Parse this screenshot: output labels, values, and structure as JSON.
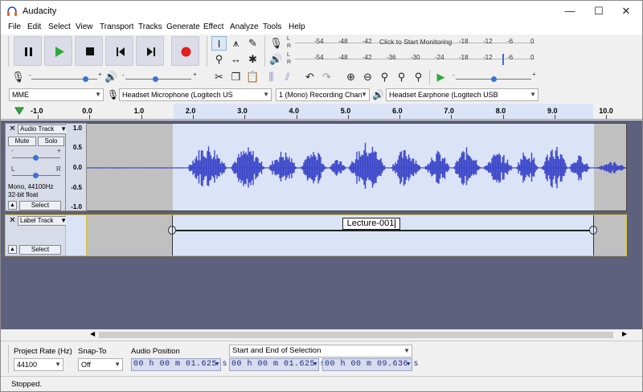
{
  "window": {
    "title": "Audacity",
    "minimize": "—",
    "maximize": "☐",
    "close": "✕"
  },
  "menu": [
    "File",
    "Edit",
    "Select",
    "View",
    "Transport",
    "Tracks",
    "Generate",
    "Effect",
    "Analyze",
    "Tools",
    "Help"
  ],
  "meters": {
    "record_ticks": [
      "-54",
      "-48",
      "-42",
      "-18",
      "-12",
      "-6",
      "0"
    ],
    "record_prompt": "Click to Start Monitoring",
    "playback_ticks": [
      "-54",
      "-48",
      "-42",
      "-36",
      "-30",
      "-24",
      "-18",
      "-12",
      "-6",
      "0"
    ],
    "left_label": "L",
    "right_label": "R"
  },
  "mixer": {
    "record_volume": 0.82,
    "playback_volume": 0.45,
    "minus": "-",
    "plus": "+"
  },
  "playspeed": {
    "value": 0.5,
    "minus": "-",
    "plus": "+"
  },
  "device": {
    "host": "MME",
    "input": "Headset Microphone (Logitech US",
    "channels": "1 (Mono) Recording Chan",
    "output": "Headset Earphone (Logitech USB"
  },
  "ruler": {
    "labels": [
      "-1.0",
      "0.0",
      "1.0",
      "2.0",
      "3.0",
      "4.0",
      "5.0",
      "6.0",
      "7.0",
      "8.0",
      "9.0",
      "10.0"
    ]
  },
  "audio_track": {
    "name": "Audio Track",
    "mute": "Mute",
    "solo": "Solo",
    "gain_minus": "-",
    "gain_plus": "+",
    "pan_left": "L",
    "pan_right": "R",
    "info_line1": "Mono, 44100Hz",
    "info_line2": "32-bit float",
    "select": "Select",
    "scale": [
      "1.0",
      "0.5",
      "0.0",
      "-0.5",
      "-1.0"
    ]
  },
  "label_track": {
    "name": "Label Track",
    "select": "Select",
    "label_text": "Lecture-001"
  },
  "selection_toolbar": {
    "project_rate_label": "Project Rate (Hz)",
    "project_rate": "44100",
    "snap_to_label": "Snap-To",
    "snap_to": "Off",
    "audio_position_label": "Audio Position",
    "audio_position": "00 h 00 m 01.625 s",
    "selection_mode": "Start and End of Selection",
    "selection_start": "00 h 00 m 01.625 s",
    "selection_end": "00 h 00 m 09.636 s"
  },
  "status": {
    "text": "Stopped."
  },
  "colors": {
    "waveform": "#3b46c9",
    "selection_bg": "#dbe4f7",
    "unselected_bg": "#c0c0c0",
    "track_area": "#5e617d",
    "record_red": "#e02020",
    "play_green": "#2eaa3c"
  }
}
